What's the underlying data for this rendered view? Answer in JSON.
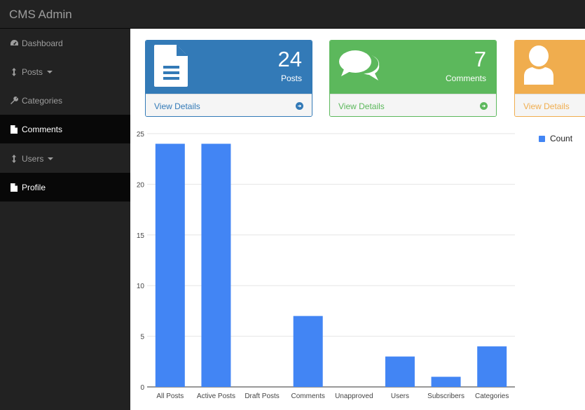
{
  "app": {
    "title": "CMS Admin"
  },
  "sidebar": {
    "items": [
      {
        "label": "Dashboard",
        "icon": "dashboard-icon",
        "active": false,
        "caret": false
      },
      {
        "label": "Posts",
        "icon": "sort-icon",
        "active": false,
        "caret": true
      },
      {
        "label": "Categories",
        "icon": "wrench-icon",
        "active": false,
        "caret": false
      },
      {
        "label": "Comments",
        "icon": "file-icon",
        "active": true,
        "caret": false
      },
      {
        "label": "Users",
        "icon": "sort-icon",
        "active": false,
        "caret": true
      },
      {
        "label": "Profile",
        "icon": "file-icon",
        "active": true,
        "caret": false
      }
    ]
  },
  "panels": [
    {
      "count": "24",
      "label": "Posts",
      "link": "View Details",
      "icon": "file-text-icon",
      "color": "#337ab7"
    },
    {
      "count": "7",
      "label": "Comments",
      "link": "View Details",
      "icon": "comments-icon",
      "color": "#5cb85c"
    },
    {
      "count": "",
      "label": "",
      "link": "View Details",
      "icon": "user-icon",
      "color": "#f0ad4e"
    }
  ],
  "chart_data": {
    "type": "bar",
    "categories": [
      "All Posts",
      "Active Posts",
      "Draft Posts",
      "Comments",
      "Unapproved",
      "Users",
      "Subscribers",
      "Categories"
    ],
    "series": [
      {
        "name": "Count",
        "values": [
          24,
          24,
          0,
          7,
          0,
          3,
          1,
          4
        ]
      }
    ],
    "ylim": [
      0,
      25
    ],
    "yticks": [
      0,
      5,
      10,
      15,
      20,
      25
    ],
    "grid": true,
    "legend_position": "right",
    "bar_color": "#4285f4"
  }
}
